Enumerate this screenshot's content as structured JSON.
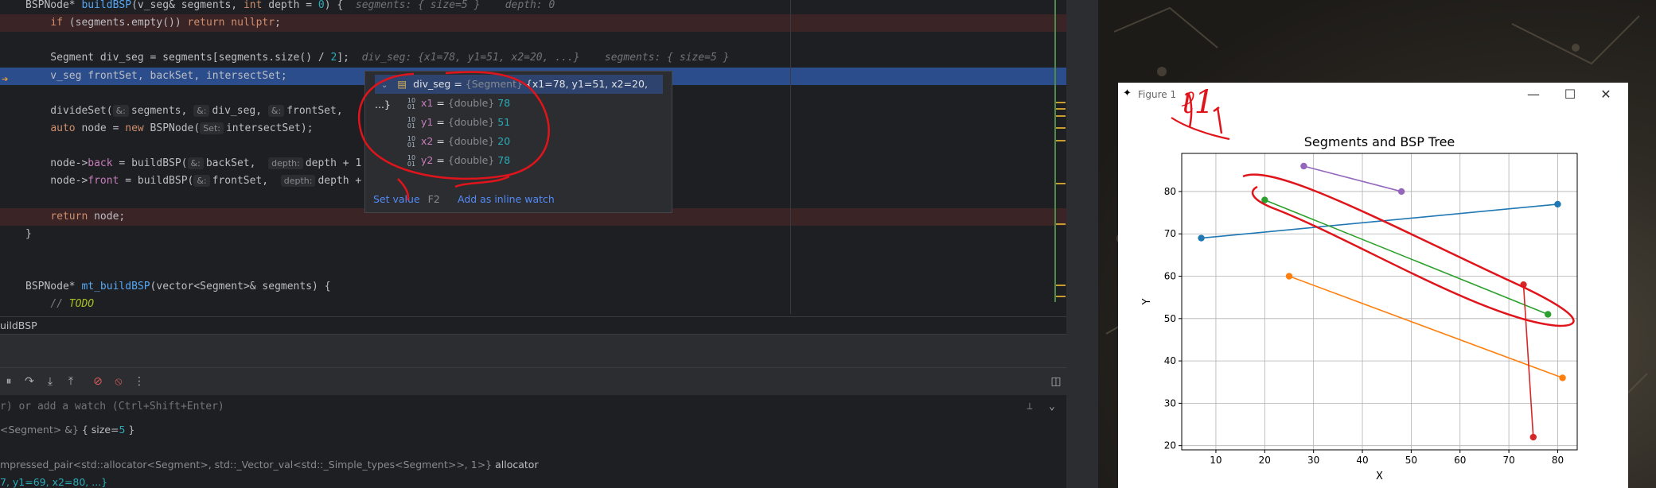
{
  "editor": {
    "lines": [
      {
        "id": "l1",
        "parts": [
          {
            "c": "",
            "t": "BSPNode* "
          },
          {
            "c": "fn",
            "t": "buildBSP"
          },
          {
            "c": "",
            "t": "(v_seg& segments, "
          },
          {
            "c": "kw",
            "t": "int"
          },
          {
            "c": "",
            "t": " depth = "
          },
          {
            "c": "num",
            "t": "0"
          },
          {
            "c": "",
            "t": ") {  "
          },
          {
            "c": "inl",
            "t": "segments: { size=5 }    depth: 0"
          }
        ]
      },
      {
        "id": "l2",
        "parts": [
          {
            "c": "",
            "t": "    "
          },
          {
            "c": "kw",
            "t": "if"
          },
          {
            "c": "",
            "t": " (segments.empty()) "
          },
          {
            "c": "kw",
            "t": "return nullptr"
          },
          {
            "c": "",
            "t": ";"
          }
        ]
      },
      {
        "id": "l3",
        "parts": []
      },
      {
        "id": "l4",
        "parts": [
          {
            "c": "",
            "t": "    Segment div_seg = segments[segments.size() / "
          },
          {
            "c": "num",
            "t": "2"
          },
          {
            "c": "",
            "t": "];  "
          },
          {
            "c": "inl",
            "t": "div_seg: {x1=78, y1=51, x2=20, ...}    segments: { size=5 }"
          }
        ]
      },
      {
        "id": "l5",
        "parts": [
          {
            "c": "",
            "t": "    v_seg frontSet, backSet, intersectSet;"
          }
        ]
      },
      {
        "id": "l6",
        "parts": []
      },
      {
        "id": "l7",
        "parts": [
          {
            "c": "",
            "t": "    divideSet("
          },
          {
            "c": "hint",
            "t": "&:"
          },
          {
            "c": "",
            "t": "segments, "
          },
          {
            "c": "hint",
            "t": "&:"
          },
          {
            "c": "",
            "t": "div_seg, "
          },
          {
            "c": "hint",
            "t": "&:"
          },
          {
            "c": "",
            "t": "frontSet,"
          }
        ]
      },
      {
        "id": "l8",
        "parts": [
          {
            "c": "",
            "t": "    "
          },
          {
            "c": "kw",
            "t": "auto"
          },
          {
            "c": "",
            "t": " node = "
          },
          {
            "c": "kw",
            "t": "new"
          },
          {
            "c": "",
            "t": " BSPNode("
          },
          {
            "c": "hint",
            "t": "Set:"
          },
          {
            "c": "",
            "t": "intersectSet);"
          }
        ]
      },
      {
        "id": "l9",
        "parts": []
      },
      {
        "id": "l10",
        "parts": [
          {
            "c": "",
            "t": "    node->"
          },
          {
            "c": "field",
            "t": "back"
          },
          {
            "c": "",
            "t": " = buildBSP("
          },
          {
            "c": "hint",
            "t": "&:"
          },
          {
            "c": "",
            "t": "backSet,  "
          },
          {
            "c": "hint",
            "t": "depth:"
          },
          {
            "c": "",
            "t": "depth + 1"
          }
        ]
      },
      {
        "id": "l11",
        "parts": [
          {
            "c": "",
            "t": "    node->"
          },
          {
            "c": "field",
            "t": "front"
          },
          {
            "c": "",
            "t": " = buildBSP("
          },
          {
            "c": "hint",
            "t": "&:"
          },
          {
            "c": "",
            "t": "frontSet,  "
          },
          {
            "c": "hint",
            "t": "depth:"
          },
          {
            "c": "",
            "t": "depth +"
          }
        ]
      },
      {
        "id": "l12",
        "parts": []
      },
      {
        "id": "l13",
        "parts": [
          {
            "c": "",
            "t": "    "
          },
          {
            "c": "kw",
            "t": "return"
          },
          {
            "c": "",
            "t": " node;"
          }
        ]
      },
      {
        "id": "l14",
        "parts": [
          {
            "c": "",
            "t": "}"
          }
        ]
      },
      {
        "id": "l15",
        "parts": []
      },
      {
        "id": "l16",
        "parts": []
      },
      {
        "id": "l17",
        "parts": [
          {
            "c": "",
            "t": "BSPNode* "
          },
          {
            "c": "fn",
            "t": "mt_buildBSP"
          },
          {
            "c": "",
            "t": "(vector<Segment>& segments) {"
          }
        ]
      },
      {
        "id": "l18",
        "parts": [
          {
            "c": "",
            "t": "    "
          },
          {
            "c": "cm",
            "t": "// "
          },
          {
            "c": "todo",
            "t": "TODO"
          }
        ]
      }
    ]
  },
  "popup": {
    "header_name": "div_seg",
    "header_eq": " = ",
    "header_type": "{Segment}",
    "header_value": " {x1=78, y1=51, x2=20, ...}",
    "fields": [
      {
        "name": "x1",
        "type": "{double}",
        "value": "78"
      },
      {
        "name": "y1",
        "type": "{double}",
        "value": "51"
      },
      {
        "name": "x2",
        "type": "{double}",
        "value": "20"
      },
      {
        "name": "y2",
        "type": "{double}",
        "value": "78"
      }
    ],
    "set_value_label": "Set value",
    "set_value_key": "F2",
    "inline_watch_label": "Add as inline watch"
  },
  "breadcrumb": "uildBSP",
  "watch_placeholder": "r) or add a watch (Ctrl+Shift+Enter)",
  "variables": [
    {
      "parts": [
        {
          "c": "typ",
          "t": "<Segment> &} "
        },
        {
          "c": "",
          "t": "{ size="
        },
        {
          "c": "val",
          "t": "5"
        },
        {
          "c": "",
          "t": " }"
        }
      ]
    },
    {
      "parts": []
    },
    {
      "parts": [
        {
          "c": "typ",
          "t": "mpressed_pair<std::allocator<Segment>, std::_Vector_val<std::_Simple_types<Segment>>, 1>} "
        },
        {
          "c": "",
          "t": "allocator"
        }
      ]
    },
    {
      "parts": [
        {
          "c": "val",
          "t": "7, y1=69, x2=80, ...}"
        }
      ]
    }
  ],
  "figure": {
    "window_title": "Figure 1",
    "minimize": "—",
    "maximize": "☐",
    "close": "✕"
  },
  "annotation_text": "ℓ1",
  "chart_data": {
    "type": "line",
    "title": "Segments and BSP Tree",
    "xlabel": "X",
    "ylabel": "Y",
    "xlim": [
      3,
      84
    ],
    "ylim": [
      19,
      89
    ],
    "xticks": [
      10,
      20,
      30,
      40,
      50,
      60,
      70,
      80
    ],
    "yticks": [
      20,
      30,
      40,
      50,
      60,
      70,
      80
    ],
    "grid": true,
    "series": [
      {
        "color": "#1f77b4",
        "points": [
          [
            7,
            69
          ],
          [
            80,
            77
          ]
        ]
      },
      {
        "color": "#ff7f0e",
        "points": [
          [
            25,
            60
          ],
          [
            81,
            36
          ]
        ]
      },
      {
        "color": "#2ca02c",
        "points": [
          [
            20,
            78
          ],
          [
            78,
            51
          ]
        ]
      },
      {
        "color": "#d62728",
        "points": [
          [
            73,
            58
          ],
          [
            75,
            22
          ]
        ]
      },
      {
        "color": "#9467bd",
        "points": [
          [
            28,
            86
          ],
          [
            48,
            80
          ]
        ]
      }
    ]
  }
}
